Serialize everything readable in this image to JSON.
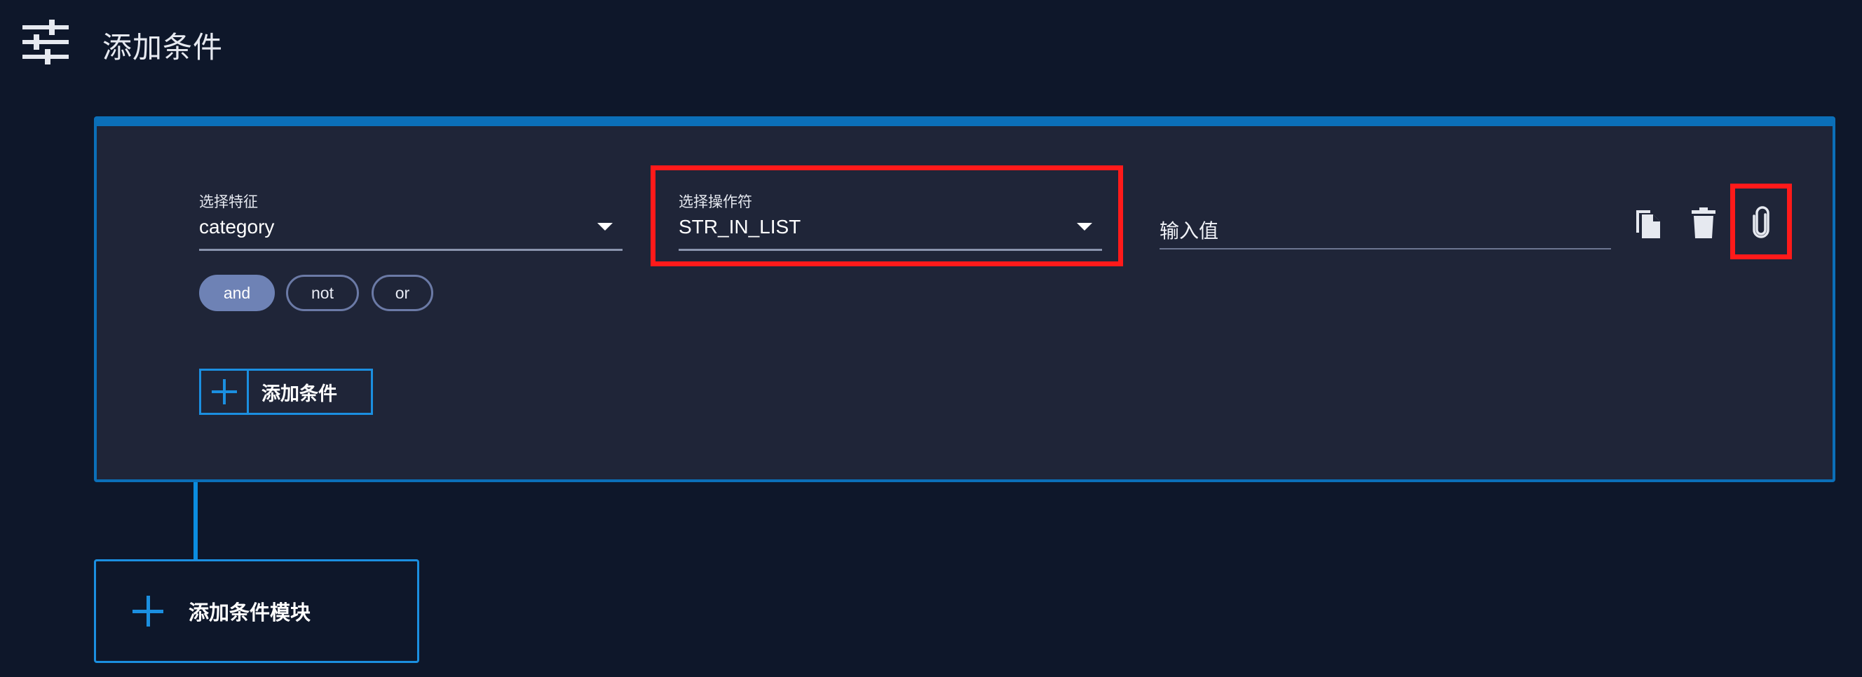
{
  "header": {
    "title": "添加条件",
    "icon": "sliders-icon"
  },
  "condition": {
    "feature": {
      "label": "选择特征",
      "value": "category"
    },
    "operator": {
      "label": "选择操作符",
      "value": "STR_IN_LIST"
    },
    "value_input": {
      "placeholder": "输入值"
    },
    "actions": {
      "copy_icon": "copy-icon",
      "delete_icon": "trash-icon",
      "attach_icon": "paperclip-icon"
    },
    "logic": {
      "options": [
        "and",
        "not",
        "or"
      ],
      "selected": "and"
    },
    "add_condition_label": "添加条件"
  },
  "add_block_label": "添加条件模块",
  "colors": {
    "background": "#0e172a",
    "card": "#1f2538",
    "accent": "#0b6fb8",
    "highlight": "#ff1a1a",
    "toggle_selected": "#6e82b5"
  }
}
